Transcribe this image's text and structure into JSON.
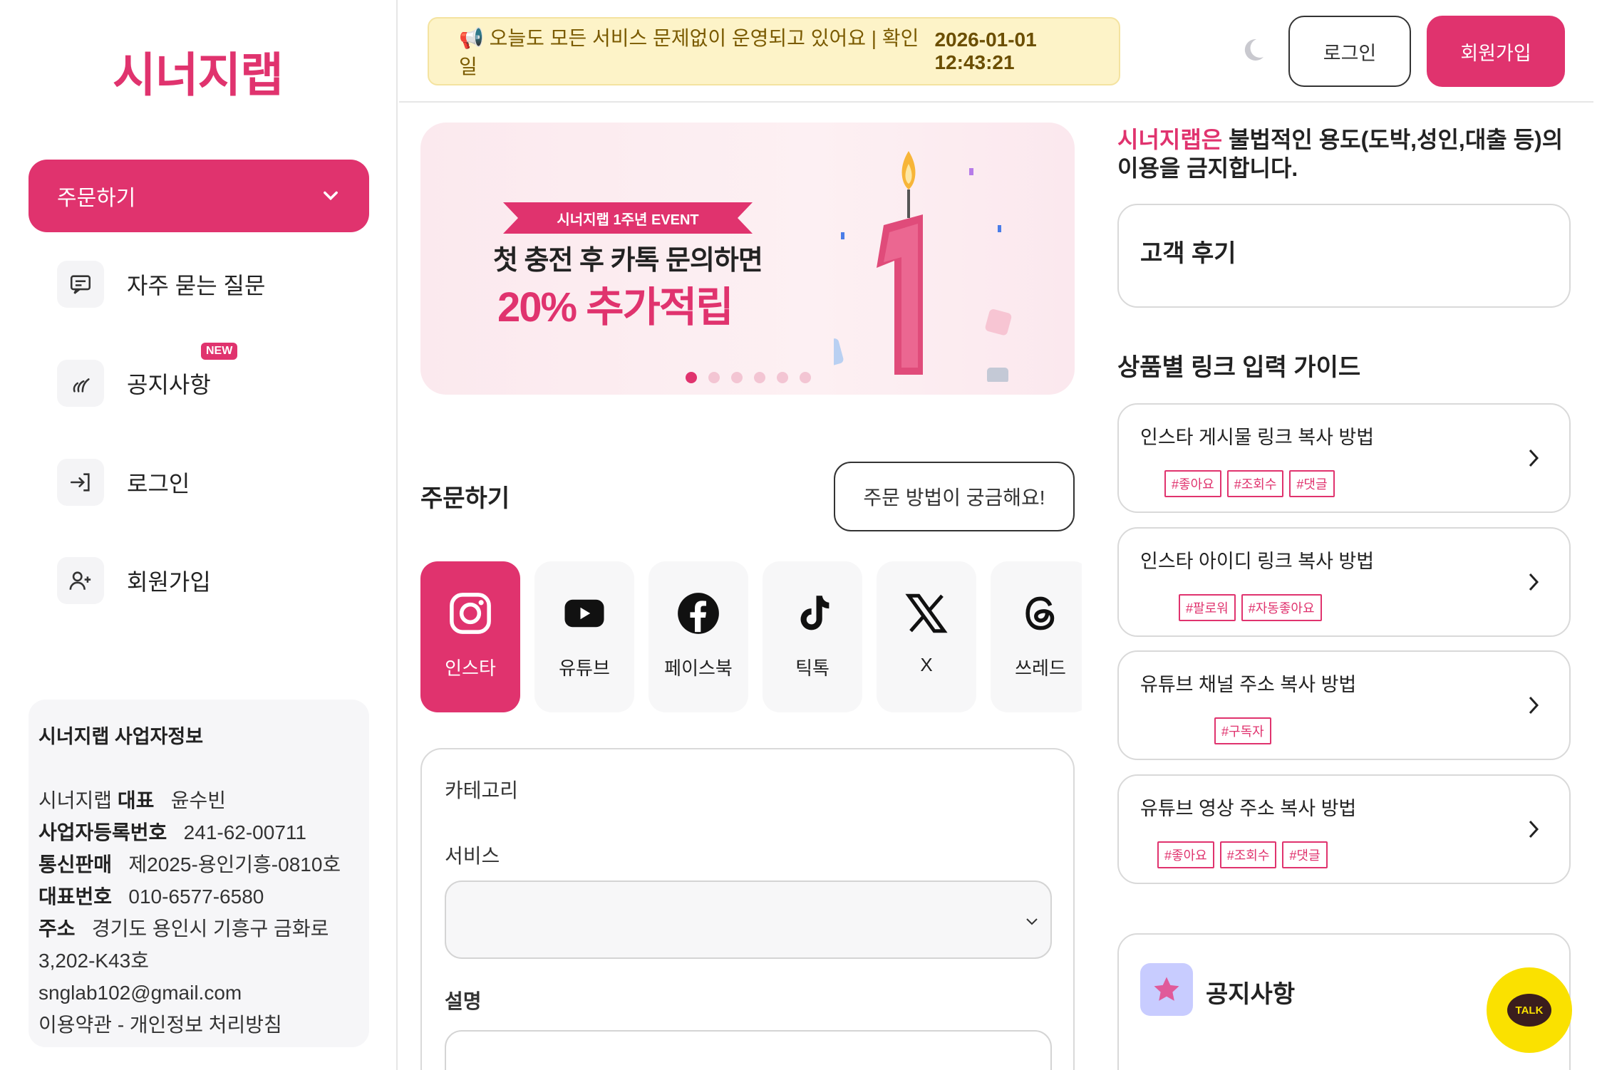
{
  "sidebar": {
    "logo": "시너지랩",
    "order_label": "주문하기",
    "items": [
      {
        "label": "자주 묻는 질문",
        "icon": "chat-icon"
      },
      {
        "label": "공지사항",
        "icon": "megaphone-icon",
        "badge": "NEW"
      },
      {
        "label": "로그인",
        "icon": "login-icon"
      },
      {
        "label": "회원가입",
        "icon": "user-add-icon"
      }
    ],
    "business": {
      "title": "시너지랩 사업자정보",
      "ceo_prefix": "시너지랩 ",
      "ceo_label": "대표",
      "ceo_value": "윤수빈",
      "reg_label": "사업자등록번호",
      "reg_value": "241-62-00711",
      "mail_order_label": "통신판매",
      "mail_order_value": "제2025-용인기흥-0810호",
      "phone_label": "대표번호",
      "phone_value": "010-6577-6580",
      "address_label": "주소",
      "address_value": "경기도 용인시 기흥구 금화로",
      "address_value2": "3,202-K43호",
      "email": "snglab102@gmail.com",
      "terms": "이용약관 - 개인정보 처리방침"
    }
  },
  "header": {
    "notice_text": "📢 오늘도 모든 서비스 문제없이 운영되고 있어요 | 확인일",
    "notice_timestamp": "2026-01-01 12:43:21",
    "login_label": "로그인",
    "join_label": "회원가입"
  },
  "banner": {
    "ribbon": "시너지랩 1주년 EVENT",
    "line1": "첫 충전 후 카톡 문의하면",
    "line2": "20% 추가적립",
    "number": "1",
    "slide_count": 6,
    "active_slide": 0
  },
  "order": {
    "title": "주문하기",
    "how_label": "주문 방법이 궁금해요!",
    "platforms": [
      {
        "label": "인스타",
        "icon": "instagram-icon",
        "active": true
      },
      {
        "label": "유튜브",
        "icon": "youtube-icon",
        "active": false
      },
      {
        "label": "페이스북",
        "icon": "facebook-icon",
        "active": false
      },
      {
        "label": "틱톡",
        "icon": "tiktok-icon",
        "active": false
      },
      {
        "label": "X",
        "icon": "x-icon",
        "active": false
      },
      {
        "label": "쓰레드",
        "icon": "threads-icon",
        "active": false
      }
    ],
    "category_label": "카테고리",
    "service_label": "서비스",
    "service_value": "",
    "description_label": "설명"
  },
  "right": {
    "warning_brand": "시너지랩은",
    "warning_text": " 불법적인 용도(도박,성인,대출 등)의 이용을 금지합니다.",
    "review_title": "고객 후기",
    "guide_title": "상품별 링크 입력 가이드",
    "guides": [
      {
        "name": "인스타 게시물 링크 복사 방법",
        "tags": [
          "#좋아요",
          "#조회수",
          "#댓글"
        ]
      },
      {
        "name": "인스타 아이디 링크 복사 방법",
        "tags": [
          "#팔로워",
          "#자동좋아요"
        ]
      },
      {
        "name": "유튜브 채널 주소 복사 방법",
        "tags": [
          "#구독자"
        ]
      },
      {
        "name": "유튜브 영상 주소 복사 방법",
        "tags": [
          "#좋아요",
          "#조회수",
          "#댓글"
        ]
      }
    ],
    "notice_title": "공지사항",
    "talk_label": "TALK"
  },
  "colors": {
    "accent": "#e0336e",
    "notice_bg": "#fdf3c8",
    "kakao": "#fae100"
  }
}
